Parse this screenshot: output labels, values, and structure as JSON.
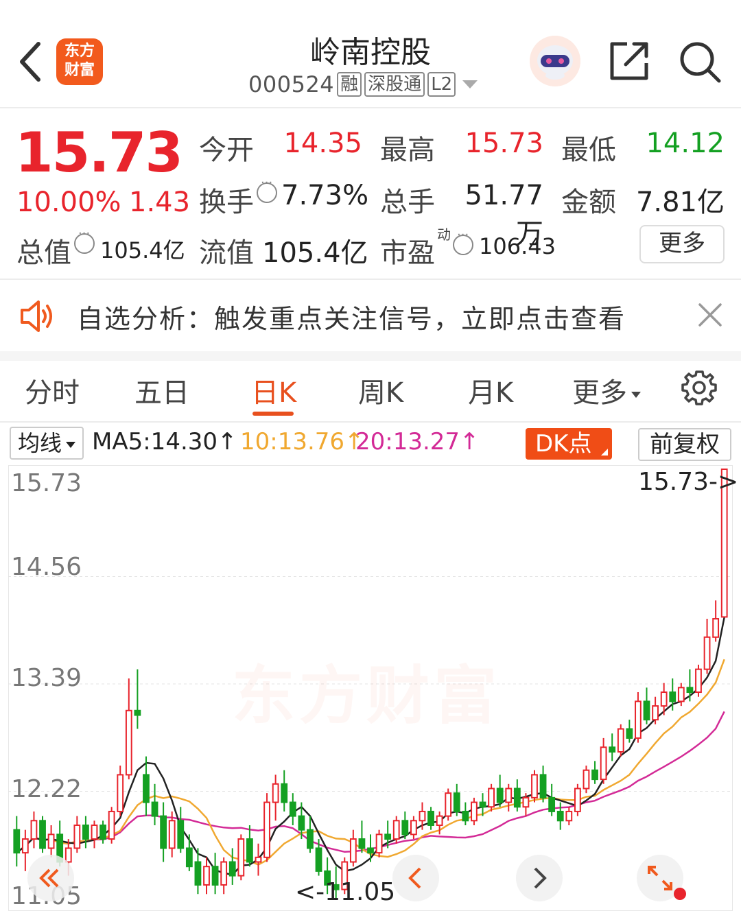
{
  "header": {
    "title": "岭南控股",
    "code": "000524",
    "tags": [
      "融",
      "深股通",
      "L2"
    ],
    "logo_lines": [
      "东方",
      "财富"
    ]
  },
  "quote": {
    "price": "15.73",
    "change_pct": "10.00%",
    "change": "1.43",
    "open_label": "今开",
    "open": "14.35",
    "high_label": "最高",
    "high": "15.73",
    "low_label": "最低",
    "low": "14.12",
    "turnover_label": "换手",
    "turnover": "7.73%",
    "volume_label": "总手",
    "volume": "51.77万",
    "amount_label": "金额",
    "amount": "7.81亿",
    "mktcap_label": "总值",
    "mktcap": "105.4亿",
    "float_label": "流值",
    "float_cap": "105.4亿",
    "pe_label": "市盈",
    "pe_sup": "动",
    "pe": "106.43",
    "more_label": "更多"
  },
  "notice": {
    "text": "自选分析：触发重点关注信号，立即点击查看"
  },
  "tabs": [
    {
      "label": "分时"
    },
    {
      "label": "五日"
    },
    {
      "label": "日K"
    },
    {
      "label": "周K"
    },
    {
      "label": "月K"
    },
    {
      "label": "更多"
    }
  ],
  "indicator": {
    "type_label": "均线",
    "ma5": "MA5:14.30↑",
    "ma10": "10:13.76↑",
    "ma20": "20:13.27↑",
    "dk_label": "DK点",
    "adjust_label": "前复权"
  },
  "chart": {
    "y_labels": [
      "15.73",
      "14.56",
      "13.39",
      "12.22",
      "11.05"
    ],
    "last_price_marker": "15.73->",
    "low_price_marker": "<-11.05",
    "watermark": "东方财富",
    "colors": {
      "up": "#e8242c",
      "down": "#14a022",
      "ma5": "#222222",
      "ma10": "#f0a830",
      "ma20": "#d32a96"
    }
  },
  "chart_data": {
    "type": "candlestick",
    "ylim": [
      11.05,
      15.73
    ],
    "ohlc": [
      [
        11.8,
        11.95,
        11.4,
        11.55
      ],
      [
        11.55,
        11.8,
        11.35,
        11.7
      ],
      [
        11.7,
        12.0,
        11.6,
        11.9
      ],
      [
        11.9,
        11.95,
        11.55,
        11.6
      ],
      [
        11.6,
        11.85,
        11.5,
        11.75
      ],
      [
        11.75,
        11.9,
        11.4,
        11.45
      ],
      [
        11.45,
        11.7,
        11.3,
        11.6
      ],
      [
        11.6,
        11.95,
        11.55,
        11.85
      ],
      [
        11.85,
        11.95,
        11.6,
        11.7
      ],
      [
        11.7,
        11.9,
        11.6,
        11.85
      ],
      [
        11.85,
        11.9,
        11.65,
        11.7
      ],
      [
        11.7,
        12.05,
        11.65,
        12.0
      ],
      [
        12.0,
        12.5,
        11.95,
        12.4
      ],
      [
        12.4,
        13.45,
        12.35,
        13.1
      ],
      [
        13.1,
        13.55,
        12.9,
        13.05
      ],
      [
        12.4,
        12.6,
        11.95,
        12.1
      ],
      [
        12.1,
        12.3,
        11.85,
        11.95
      ],
      [
        11.95,
        12.1,
        11.45,
        11.6
      ],
      [
        11.6,
        12.0,
        11.5,
        11.9
      ],
      [
        11.9,
        12.05,
        11.55,
        11.6
      ],
      [
        11.6,
        11.75,
        11.35,
        11.4
      ],
      [
        11.45,
        11.6,
        11.1,
        11.2
      ],
      [
        11.2,
        11.5,
        11.1,
        11.4
      ],
      [
        11.4,
        11.55,
        11.1,
        11.2
      ],
      [
        11.2,
        11.5,
        11.1,
        11.45
      ],
      [
        11.45,
        11.6,
        11.2,
        11.3
      ],
      [
        11.3,
        11.75,
        11.25,
        11.7
      ],
      [
        11.7,
        11.85,
        11.4,
        11.45
      ],
      [
        11.45,
        11.65,
        11.3,
        11.5
      ],
      [
        11.5,
        12.2,
        11.45,
        12.1
      ],
      [
        12.1,
        12.4,
        11.9,
        12.3
      ],
      [
        12.3,
        12.45,
        12.0,
        12.1
      ],
      [
        12.1,
        12.2,
        11.85,
        11.95
      ],
      [
        11.95,
        12.1,
        11.7,
        11.8
      ],
      [
        11.8,
        11.95,
        11.55,
        11.6
      ],
      [
        11.6,
        11.7,
        11.3,
        11.35
      ],
      [
        11.35,
        11.5,
        11.1,
        11.2
      ],
      [
        11.2,
        11.4,
        11.05,
        11.15
      ],
      [
        11.15,
        11.5,
        11.1,
        11.45
      ],
      [
        11.45,
        11.8,
        11.4,
        11.7
      ],
      [
        11.7,
        11.9,
        11.55,
        11.6
      ],
      [
        11.6,
        11.75,
        11.45,
        11.55
      ],
      [
        11.55,
        11.8,
        11.5,
        11.75
      ],
      [
        11.75,
        11.9,
        11.6,
        11.7
      ],
      [
        11.7,
        11.95,
        11.65,
        11.9
      ],
      [
        11.9,
        12.0,
        11.7,
        11.75
      ],
      [
        11.75,
        11.95,
        11.7,
        11.9
      ],
      [
        11.9,
        12.1,
        11.8,
        12.0
      ],
      [
        12.0,
        12.05,
        11.8,
        11.85
      ],
      [
        11.85,
        12.0,
        11.75,
        11.95
      ],
      [
        11.95,
        12.25,
        11.9,
        12.2
      ],
      [
        12.2,
        12.3,
        11.95,
        12.0
      ],
      [
        12.0,
        12.1,
        11.85,
        11.9
      ],
      [
        11.9,
        12.15,
        11.85,
        12.1
      ],
      [
        12.1,
        12.2,
        11.95,
        12.05
      ],
      [
        12.05,
        12.3,
        12.0,
        12.25
      ],
      [
        12.25,
        12.4,
        12.05,
        12.1
      ],
      [
        12.1,
        12.3,
        12.0,
        12.25
      ],
      [
        12.25,
        12.35,
        12.0,
        12.05
      ],
      [
        12.05,
        12.2,
        11.95,
        12.15
      ],
      [
        12.15,
        12.45,
        12.1,
        12.4
      ],
      [
        12.4,
        12.5,
        12.1,
        12.15
      ],
      [
        12.15,
        12.3,
        11.95,
        12.0
      ],
      [
        12.0,
        12.1,
        11.8,
        11.9
      ],
      [
        11.9,
        12.05,
        11.85,
        12.0
      ],
      [
        12.0,
        12.3,
        11.95,
        12.25
      ],
      [
        12.25,
        12.5,
        12.2,
        12.45
      ],
      [
        12.45,
        12.55,
        12.3,
        12.35
      ],
      [
        12.35,
        12.8,
        12.3,
        12.7
      ],
      [
        12.7,
        12.85,
        12.55,
        12.65
      ],
      [
        12.65,
        12.95,
        12.6,
        12.9
      ],
      [
        12.9,
        13.0,
        12.75,
        12.8
      ],
      [
        12.8,
        13.3,
        12.75,
        13.2
      ],
      [
        13.2,
        13.35,
        12.95,
        13.0
      ],
      [
        13.0,
        13.25,
        12.95,
        13.15
      ],
      [
        13.15,
        13.4,
        13.05,
        13.3
      ],
      [
        13.3,
        13.45,
        13.1,
        13.2
      ],
      [
        13.2,
        13.4,
        13.15,
        13.35
      ],
      [
        13.35,
        13.55,
        13.2,
        13.3
      ],
      [
        13.3,
        13.6,
        13.25,
        13.55
      ],
      [
        13.55,
        14.1,
        13.5,
        13.9
      ],
      [
        13.9,
        14.3,
        13.85,
        14.1
      ],
      [
        14.12,
        15.73,
        14.12,
        15.73
      ]
    ]
  }
}
